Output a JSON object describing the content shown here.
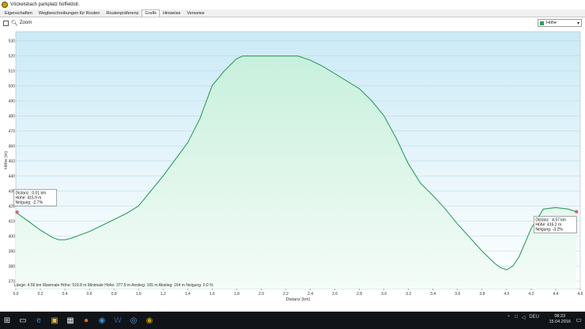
{
  "window": {
    "title": "Vöckelsbach parkplatz hoffeldstr."
  },
  "tabs": [
    {
      "label": "Eigenschaften",
      "active": false
    },
    {
      "label": "Wegbeschreibungen für Routen",
      "active": false
    },
    {
      "label": "Routenpräferenz",
      "active": false
    },
    {
      "label": "Grafik",
      "active": true
    },
    {
      "label": "Hinweise",
      "active": false
    },
    {
      "label": "Verweise",
      "active": false
    }
  ],
  "toolbar": {
    "zoom_label": "Zoom",
    "series_select": "Höhe"
  },
  "chart_data": {
    "type": "area",
    "xlabel": "Distanz  (km)",
    "ylabel": "Höhe (m)",
    "xlim": [
      0.0,
      4.6
    ],
    "ylim": [
      365,
      536
    ],
    "x_ticks": [
      "0.0",
      "0.2",
      "0.4",
      "0.6",
      "0.8",
      "1.0",
      "1.2",
      "1.4",
      "1.6",
      "1.8",
      "2.0",
      "2.2",
      "2.4",
      "2.6",
      "2.8",
      "3.0",
      "3.2",
      "3.4",
      "3.6",
      "3.8",
      "4.0",
      "4.2",
      "4.4",
      "4.6"
    ],
    "y_ticks": [
      "370",
      "380",
      "390",
      "400",
      "410",
      "420",
      "430",
      "440",
      "450",
      "460",
      "470",
      "480",
      "490",
      "500",
      "510",
      "520",
      "530"
    ],
    "grid": true,
    "colors": {
      "line": "#2e9e5a",
      "fill_top": "#c8f0dc",
      "fill_bottom": "#f4fcf8",
      "plot_bg_top": "#cbeaf6",
      "plot_bg_bottom": "#ffffff"
    },
    "series": [
      {
        "x": [
          0.0,
          0.1,
          0.2,
          0.3,
          0.35,
          0.4,
          0.45,
          0.5,
          0.6,
          0.7,
          0.8,
          0.9,
          1.0,
          1.2,
          1.4,
          1.5,
          1.6,
          1.7,
          1.8,
          1.85,
          1.9,
          2.0,
          2.1,
          2.2,
          2.3,
          2.4,
          2.5,
          2.6,
          2.7,
          2.8,
          2.9,
          3.0,
          3.1,
          3.2,
          3.3,
          3.4,
          3.5,
          3.6,
          3.7,
          3.8,
          3.9,
          3.95,
          4.0,
          4.05,
          4.1,
          4.2,
          4.3,
          4.4,
          4.5,
          4.57
        ],
        "values": [
          415.9,
          410,
          404,
          399,
          397.5,
          397.5,
          398.5,
          400,
          403,
          407,
          411,
          415,
          420,
          440,
          462,
          478,
          500,
          510,
          518,
          519.8,
          519.8,
          519.8,
          519.8,
          519.8,
          519.8,
          517,
          513,
          508,
          503,
          498,
          490,
          480,
          465,
          448,
          435,
          427,
          418,
          408,
          399,
          390,
          382,
          379,
          377.5,
          380,
          386,
          405,
          418,
          419,
          418,
          416.2
        ]
      }
    ],
    "tooltips": [
      {
        "x": 0.01,
        "y": 415.9,
        "side": "right",
        "lines": [
          "Distanz : 0.01 km",
          "Höhe: 415.9 m",
          "Neigung: -2.7%"
        ]
      },
      {
        "x": 4.57,
        "y": 416.2,
        "side": "left",
        "lines": [
          "Distanz : 4.57 km",
          "Höhe: 416.2 m",
          "Neigung: -3.2%"
        ]
      }
    ],
    "stats": "Länge: 4.56 km    Maximale Höhe: 519.8 m    Minimale Höhe: 377.5 m    Anstieg: 165 m    Abstieg: 164 m    Neigung: 0.0 %"
  },
  "taskbar": {
    "clock_time": "08:23",
    "clock_date": "15.04.2016",
    "tray_text": "DEU"
  }
}
